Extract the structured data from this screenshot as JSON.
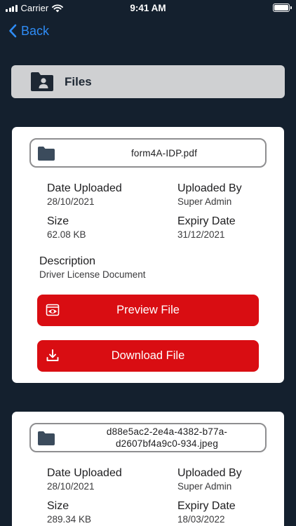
{
  "status_bar": {
    "carrier": "Carrier",
    "time": "9:41 AM"
  },
  "nav": {
    "back_label": "Back"
  },
  "header": {
    "title": "Files",
    "icon": "folder-user-icon"
  },
  "labels": {
    "date_uploaded": "Date Uploaded",
    "uploaded_by": "Uploaded By",
    "size": "Size",
    "expiry_date": "Expiry Date",
    "description": "Description",
    "preview": "Preview File",
    "download": "Download File"
  },
  "files": [
    {
      "name": "form4A-IDP.pdf",
      "date_uploaded": "28/10/2021",
      "uploaded_by": "Super Admin",
      "size": "62.08 KB",
      "expiry_date": "31/12/2021",
      "description": "Driver License Document"
    },
    {
      "name": "d88e5ac2-2e4a-4382-b77a-d2607bf4a9c0-934.jpeg",
      "date_uploaded": "28/10/2021",
      "uploaded_by": "Super Admin",
      "size": "289.34 KB",
      "expiry_date": "18/03/2022"
    }
  ],
  "colors": {
    "background": "#14202e",
    "accent_blue": "#2f8cf5",
    "button_red": "#d90d12",
    "header_gray": "#cfd0d2"
  }
}
